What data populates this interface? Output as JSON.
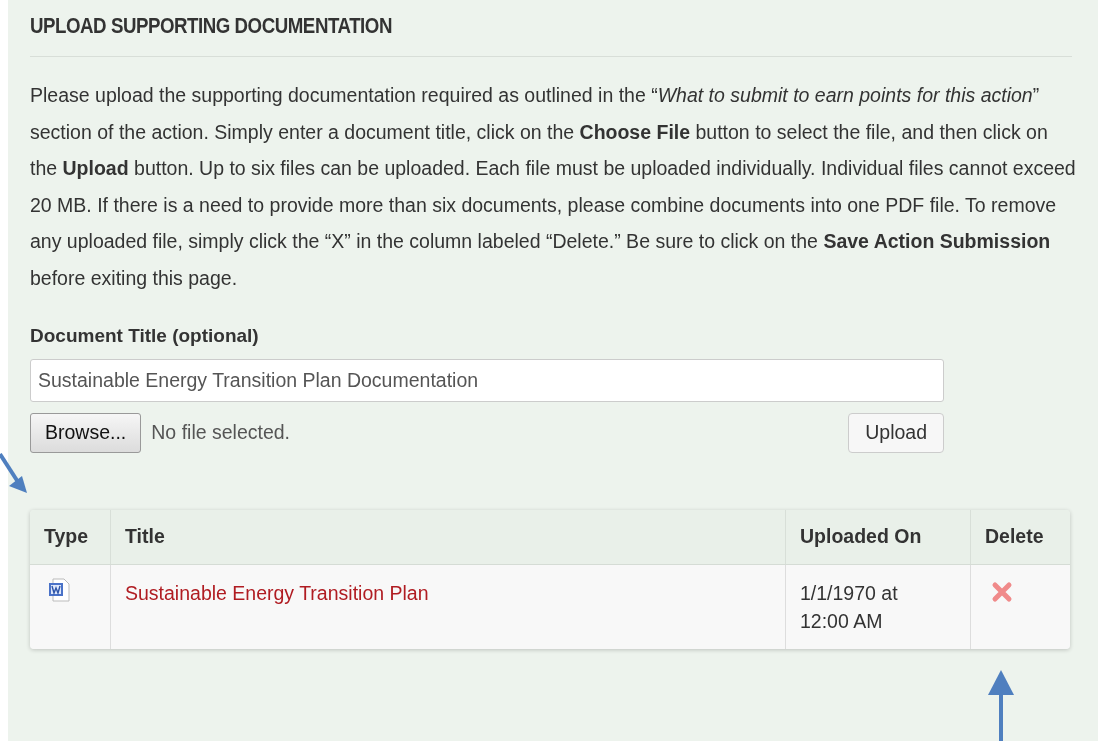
{
  "section": {
    "title": "UPLOAD SUPPORTING DOCUMENTATION",
    "instructions": "Please upload the supporting documentation required as outlined in the “*What to submit to earn points for this action*” section of the action. Simply enter a document title, click on the **Choose File** button to select the file, and then click on the **Upload** button. Up to six files can be uploaded. Each file must be uploaded individually. Individual files cannot exceed 20 MB. If there is a need to provide more than six documents, please combine documents into one PDF file. To remove any uploaded file, simply click the “X” in the column labeled “Delete.” Be sure to click on the **Save Action Submission** before exiting this page."
  },
  "form": {
    "label": "Document Title (optional)",
    "value": "Sustainable Energy Transition Plan Documentation",
    "browse_button": "Browse...",
    "file_status": "No file selected.",
    "upload_button": "Upload"
  },
  "table": {
    "columns": [
      "Type",
      "Title",
      "Uploaded On",
      "Delete"
    ],
    "rows": [
      {
        "title": "Sustainable Energy Transition Plan",
        "uploaded_on": "1/1/1970 at 12:00 AM"
      }
    ]
  }
}
